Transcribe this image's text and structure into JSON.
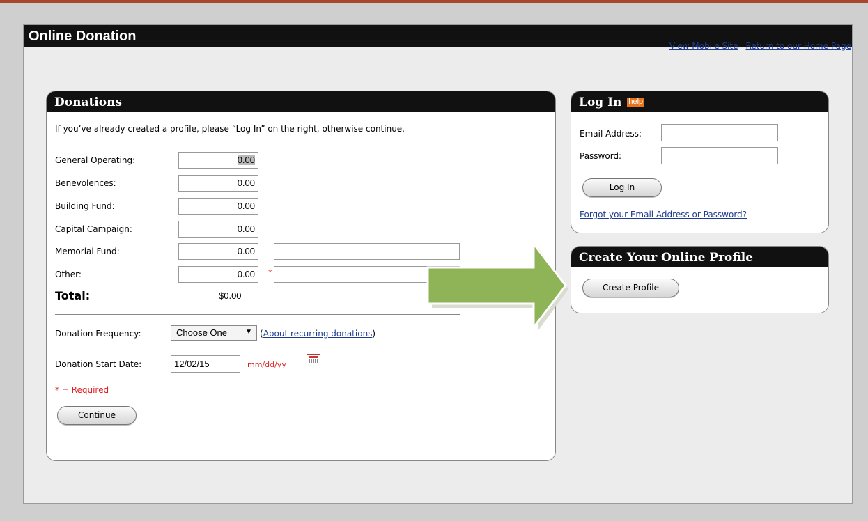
{
  "window": {
    "title": "Online Donation"
  },
  "top_links": {
    "mobile": "View Mobile Site",
    "home": "Return to our Home Page"
  },
  "donations": {
    "title": "Donations",
    "intro": "If you’ve already created a profile, please “Log In” on the right, otherwise continue.",
    "funds": [
      {
        "label": "General Operating:",
        "value": "0.00"
      },
      {
        "label": "Benevolences:",
        "value": "0.00"
      },
      {
        "label": "Building Fund:",
        "value": "0.00"
      },
      {
        "label": "Capital Campaign:",
        "value": "0.00"
      },
      {
        "label": "Memorial Fund:",
        "value": "0.00",
        "note_value": ""
      },
      {
        "label": "Other:",
        "value": "0.00",
        "required_marker": "*",
        "note_value": ""
      }
    ],
    "total_label": "Total:",
    "total_value": "$0.00",
    "frequency_label": "Donation Frequency:",
    "frequency_selected": "Choose One",
    "frequency_link_open": "(",
    "frequency_link": "About recurring donations",
    "frequency_link_close": ")",
    "start_label": "Donation Start Date:",
    "start_value": "12/02/15",
    "date_format_hint": "mm/dd/yy",
    "required_note": "* = Required",
    "continue_label": "Continue"
  },
  "login": {
    "title": "Log In",
    "help_badge": "help",
    "email_label": "Email Address:",
    "email_value": "",
    "password_label": "Password:",
    "password_value": "",
    "button_label": "Log In",
    "forgot_link": "Forgot your Email Address or Password?"
  },
  "profile": {
    "title": "Create Your Online Profile",
    "button_label": "Create Profile"
  },
  "icons": {
    "calendar": "calendar-icon",
    "dropdown_arrow": "triangle-down-icon",
    "pointer": "arrow-right-icon"
  },
  "colors": {
    "header_bg": "#111111",
    "link": "#1f3c8f",
    "required": "#e02020",
    "help_badge": "#e8731a",
    "arrow": "#8fb457",
    "top_rule": "#a8472d"
  }
}
